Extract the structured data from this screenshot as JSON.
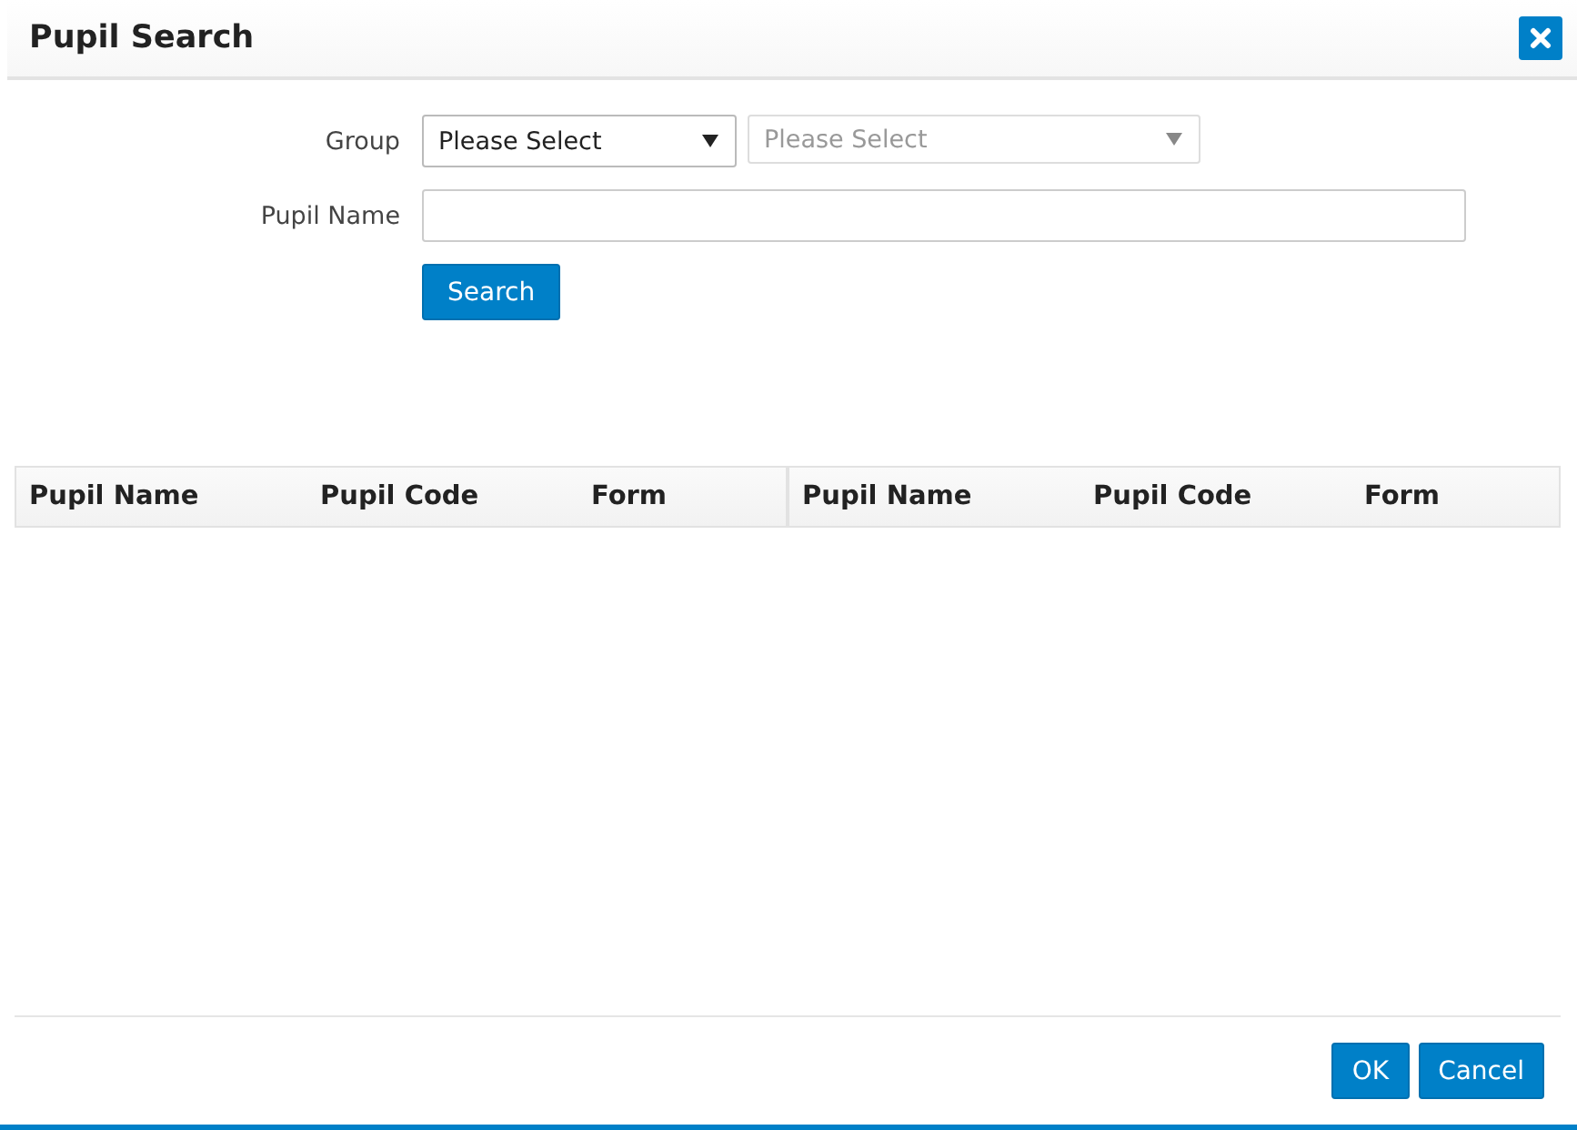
{
  "dialog": {
    "title": "Pupil Search"
  },
  "form": {
    "group_label": "Group",
    "group_selects": [
      {
        "value": "Please Select",
        "disabled": false
      },
      {
        "value": "Please Select",
        "disabled": true
      }
    ],
    "pupil_name_label": "Pupil Name",
    "search_button": "Search"
  },
  "table": {
    "column_groups": [
      [
        "Pupil Name",
        "Pupil Code",
        "Form"
      ],
      [
        "Pupil Name",
        "Pupil Code",
        "Form"
      ]
    ]
  },
  "buttons": [
    "OK",
    "Cancel"
  ]
}
